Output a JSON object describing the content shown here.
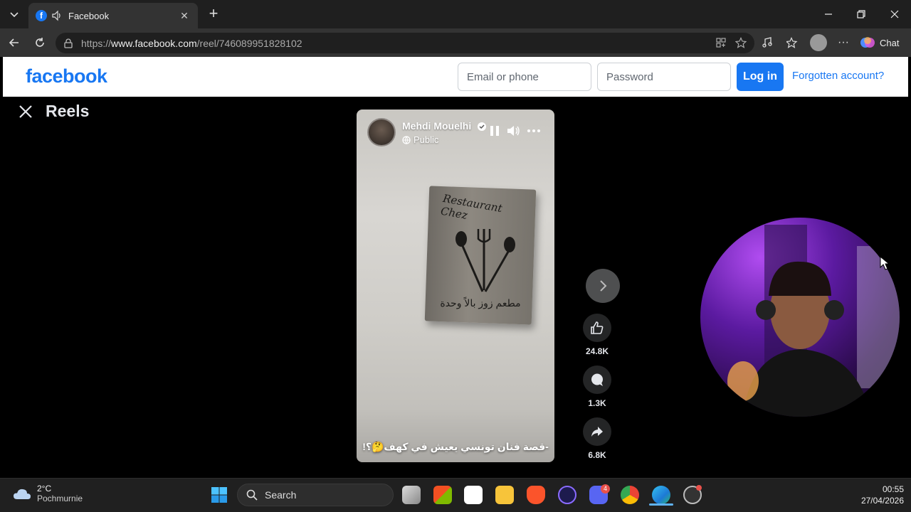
{
  "browser": {
    "tab_title": "Facebook",
    "tab_favicon": "f",
    "url_prefix": "https://",
    "url_domain": "www.facebook.com",
    "url_path": "/reel/746089951828102",
    "chat_label": "Chat"
  },
  "facebook": {
    "logo": "facebook",
    "email_placeholder": "Email or phone",
    "password_placeholder": "Password",
    "login_label": "Log in",
    "forgot_label": "Forgotten account?",
    "brand_color": "#1877f2"
  },
  "reels": {
    "title": "Reels",
    "creator_name": "Mehdi Mouelhi",
    "privacy": "Public",
    "caption": "-قصة فنان تونسي يعيش في كهف🤔؟!",
    "sign_text": "Restaurant Chez",
    "sign_arabic": "مطعم زوز بالاً وحدة",
    "actions": {
      "likes": "24.8K",
      "comments": "1.3K",
      "shares": "6.8K"
    }
  },
  "taskbar": {
    "temperature": "2°C",
    "weather_desc": "Pochmurnie",
    "search_label": "Search",
    "time": "00:55",
    "date": "27/04/2026",
    "discord_badge": "4"
  }
}
